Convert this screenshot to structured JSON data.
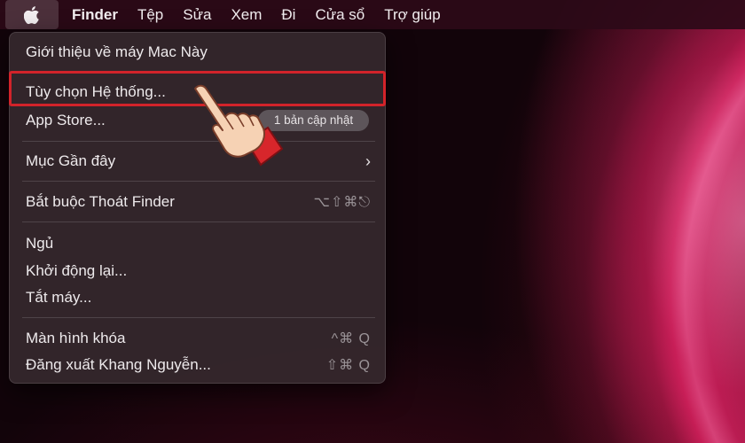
{
  "menubar": {
    "apple_icon": "apple-logo-icon",
    "items": [
      "Finder",
      "Tệp",
      "Sửa",
      "Xem",
      "Đi",
      "Cửa sổ",
      "Trợ giúp"
    ]
  },
  "apple_menu": {
    "about": "Giới thiệu về máy Mac Này",
    "system_prefs": "Tùy chọn Hệ thống...",
    "app_store": "App Store...",
    "app_store_badge": "1 bản cập nhật",
    "recent_items": "Mục Gần đây",
    "recent_chevron": "›",
    "force_quit": "Bắt buộc Thoát Finder",
    "force_quit_shortcut": "⌥⇧⌘⎋",
    "sleep": "Ngủ",
    "restart": "Khởi động lại...",
    "shutdown": "Tắt máy...",
    "lock_screen": "Màn hình khóa",
    "lock_screen_shortcut": "^⌘ Q",
    "logout": "Đăng xuất Khang Nguyễn...",
    "logout_shortcut": "⇧⌘ Q"
  },
  "colors": {
    "highlight_border": "#d2232a",
    "menu_bg": "#34262c"
  }
}
